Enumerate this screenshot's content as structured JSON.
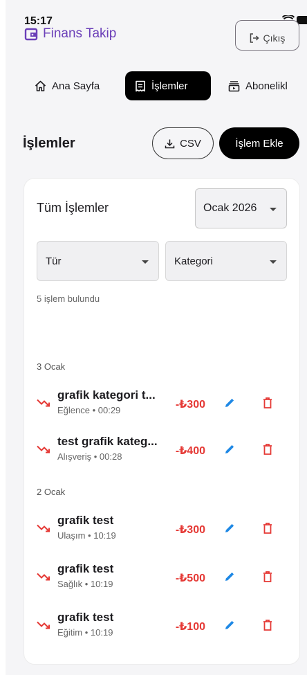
{
  "status_bar": {
    "time": "15:17"
  },
  "app": {
    "title": "Finans Takip",
    "logout_label": "Çıkış"
  },
  "nav": {
    "home": "Ana Sayfa",
    "transactions": "İşlemler",
    "subscriptions": "Abonelikl"
  },
  "section": {
    "title": "İşlemler",
    "csv_label": "CSV",
    "add_label": "İşlem Ekle"
  },
  "card": {
    "title": "Tüm İşlemler",
    "month": "Ocak 2026",
    "type_filter": "Tür",
    "category_filter": "Kategori",
    "count": "5 işlem bulundu"
  },
  "groups": [
    {
      "date": "3 Ocak",
      "items": [
        {
          "title": "grafik kategori t...",
          "subtitle": "Eğlence • 00:29",
          "amount": "-₺300"
        },
        {
          "title": "test grafik kateg...",
          "subtitle": "Alışveriş • 00:28",
          "amount": "-₺400"
        }
      ]
    },
    {
      "date": "2 Ocak",
      "items": [
        {
          "title": "grafik test",
          "subtitle": "Ulaşım • 10:19",
          "amount": "-₺300"
        },
        {
          "title": "grafik test",
          "subtitle": "Sağlık • 10:19",
          "amount": "-₺500"
        },
        {
          "title": "grafik test",
          "subtitle": "Eğitim • 10:19",
          "amount": "-₺100"
        }
      ]
    }
  ],
  "colors": {
    "brand": "#6b3fb8",
    "expense": "#e53935",
    "edit": "#1e88e5",
    "delete": "#e53935"
  }
}
